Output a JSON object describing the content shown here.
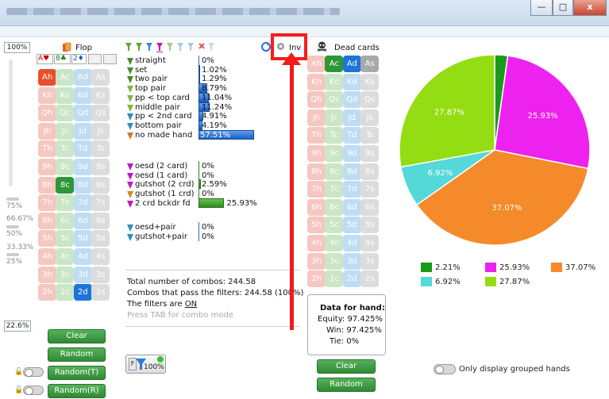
{
  "window": {
    "controls": {
      "minimize": "—",
      "maximize": "□",
      "close": "x"
    }
  },
  "board": {
    "label": "Flop",
    "zoom_top": "100%",
    "zoom_bottom": "22.6%",
    "slots": [
      "A♥",
      "8♣",
      "2♦",
      "",
      ""
    ],
    "slider_ticks": [
      "75%",
      "66.67%",
      "50%",
      "33.33%",
      "25%"
    ],
    "ranks": [
      "A",
      "K",
      "Q",
      "J",
      "T",
      "9",
      "8",
      "7",
      "6",
      "5",
      "4",
      "3",
      "2"
    ],
    "suits": [
      "h",
      "c",
      "d",
      "s"
    ],
    "selected": [
      "Ah",
      "8c",
      "2d"
    ],
    "buttons": {
      "clear": "Clear",
      "random": "Random",
      "random_t": "Random(T)",
      "random_r": "Random(R)"
    }
  },
  "filters": {
    "inv_label": "Inv",
    "made_hands": [
      {
        "label": "straight",
        "value": "0%",
        "pct": 0.0
      },
      {
        "label": "set",
        "value": "1.02%",
        "pct": 1.02
      },
      {
        "label": "two pair",
        "value": "1.29%",
        "pct": 1.29
      },
      {
        "label": "top pair",
        "value": "8.79%",
        "pct": 8.79
      },
      {
        "label": "pp < top card",
        "value": "11.04%",
        "pct": 11.04
      },
      {
        "label": "middle pair",
        "value": "11.24%",
        "pct": 11.24
      },
      {
        "label": "pp < 2nd card",
        "value": "4.91%",
        "pct": 4.91
      },
      {
        "label": "bottom pair",
        "value": "4.19%",
        "pct": 4.19
      },
      {
        "label": "no made hand",
        "value": "57.51%",
        "pct": 57.51
      }
    ],
    "draws": [
      {
        "label": "oesd (2 card)",
        "value": "0%",
        "pct": 0.0
      },
      {
        "label": "oesd (1 card)",
        "value": "0%",
        "pct": 0.0
      },
      {
        "label": "gutshot (2 crd)",
        "value": "2.59%",
        "pct": 2.59
      },
      {
        "label": "gutshot (1 crd)",
        "value": "0%",
        "pct": 0.0
      },
      {
        "label": "2 crd bckdr fd",
        "value": "25.93%",
        "pct": 25.93
      }
    ],
    "combos": [
      {
        "label": "oesd+pair",
        "value": "0%",
        "pct": 0.0
      },
      {
        "label": "gutshot+pair",
        "value": "0%",
        "pct": 0.0
      }
    ],
    "summary": {
      "total": "Total number of combos: 244.58",
      "pass": "Combos that pass the filters: 244.58 (100%)",
      "filters_prefix": "The filters are ",
      "filters_state": "ON",
      "tab_hint": "Press TAB for combo mode"
    },
    "filter_button_pct": "100%"
  },
  "dead_cards": {
    "label": "Dead cards",
    "selected": [
      "Ac",
      "Ad",
      "As"
    ],
    "buttons": {
      "clear": "Clear",
      "random": "Random"
    }
  },
  "hand_data": {
    "title": "Data for hand:",
    "equity_label": "Equity:",
    "equity": "97.425%",
    "win_label": "Win:",
    "win": "97.425%",
    "tie_label": "Tie:",
    "tie": "0%"
  },
  "chart_data": {
    "type": "pie",
    "series": [
      {
        "value": 2.21,
        "color": "#1a9a1a",
        "label": "2.21%"
      },
      {
        "value": 25.93,
        "color": "#ee22ee",
        "label": "25.93%"
      },
      {
        "value": 37.07,
        "color": "#f58a2a",
        "label": "37.07%"
      },
      {
        "value": 6.92,
        "color": "#55d8d8",
        "label": "6.92%"
      },
      {
        "value": 27.87,
        "color": "#94dd12",
        "label": "27.87%"
      }
    ]
  },
  "toggle_label": "Only display grouped hands"
}
